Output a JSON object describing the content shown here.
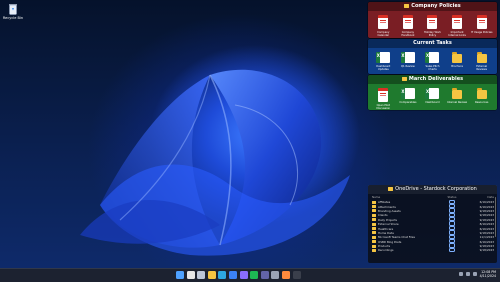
{
  "desktop": {
    "recycle_bin_label": "Recycle Bin"
  },
  "fences": [
    {
      "title": "Company Policies",
      "color": "#7a1e24",
      "items": [
        {
          "label": "Company Calendar",
          "icon": "pdf-file-icon"
        },
        {
          "label": "Company Handbook",
          "icon": "pdf-file-icon"
        },
        {
          "label": "Holiday Work Policy",
          "icon": "pdf-file-icon"
        },
        {
          "label": "Important Internal Links",
          "icon": "pdf-file-icon"
        },
        {
          "label": "IT Usage Policies",
          "icon": "pdf-file-icon"
        }
      ]
    },
    {
      "title": "Current Tasks",
      "color": "#0f3f8a",
      "items": [
        {
          "label": "Dashboard Updates",
          "icon": "excel-file-icon"
        },
        {
          "label": "Q1 Review",
          "icon": "excel-file-icon"
        },
        {
          "label": "Sales Pitch Charts",
          "icon": "excel-file-icon"
        },
        {
          "label": "Brochure",
          "icon": "folder-icon"
        },
        {
          "label": "External Reviews",
          "icon": "folder-icon"
        }
      ]
    },
    {
      "title": "March Deliverables",
      "color": "#1f7a2e",
      "items": [
        {
          "label": "Open Pilot Discussion",
          "icon": "pdf-file-icon"
        },
        {
          "label": "Comparables",
          "icon": "excel-file-icon"
        },
        {
          "label": "Dashboard",
          "icon": "excel-file-icon"
        },
        {
          "label": "Internal Review",
          "icon": "folder-icon"
        },
        {
          "label": "Resources",
          "icon": "folder-icon"
        }
      ]
    }
  ],
  "onedrive": {
    "title": "OneDrive - Stardock Corporation",
    "columns": {
      "name": "Name",
      "status": "Status",
      "date": "Date"
    },
    "rows": [
      {
        "name": "Affiliates",
        "date": "6/16/2023"
      },
      {
        "name": "Attachments",
        "date": "6/16/2023"
      },
      {
        "name": "Branding Assets",
        "date": "9/18/2023"
      },
      {
        "name": "Clients",
        "date": "9/18/2023"
      },
      {
        "name": "Daily Projects",
        "date": "9/18/2023"
      },
      {
        "name": "External Share",
        "date": "8/16/2023"
      },
      {
        "name": "Healthcare",
        "date": "6/16/2023"
      },
      {
        "name": "Home Data",
        "date": "9/18/2023"
      },
      {
        "name": "Microsoft Teams Chat Files",
        "date": "11/1/2023"
      },
      {
        "name": "OSBD Blog Posts",
        "date": "6/16/2023"
      },
      {
        "name": "Products",
        "date": "9/18/2023"
      },
      {
        "name": "Recordings",
        "date": "9/18/2023"
      }
    ]
  },
  "taskbar": {
    "icons": [
      "windows-start-icon",
      "search-icon",
      "task-view-icon",
      "file-explorer-icon",
      "edge-browser-icon",
      "mail-icon",
      "store-icon",
      "spotify-icon",
      "teams-icon",
      "settings-icon",
      "photos-icon",
      "terminal-icon"
    ],
    "time": "12:08 PM",
    "date": "4/11/2024"
  }
}
